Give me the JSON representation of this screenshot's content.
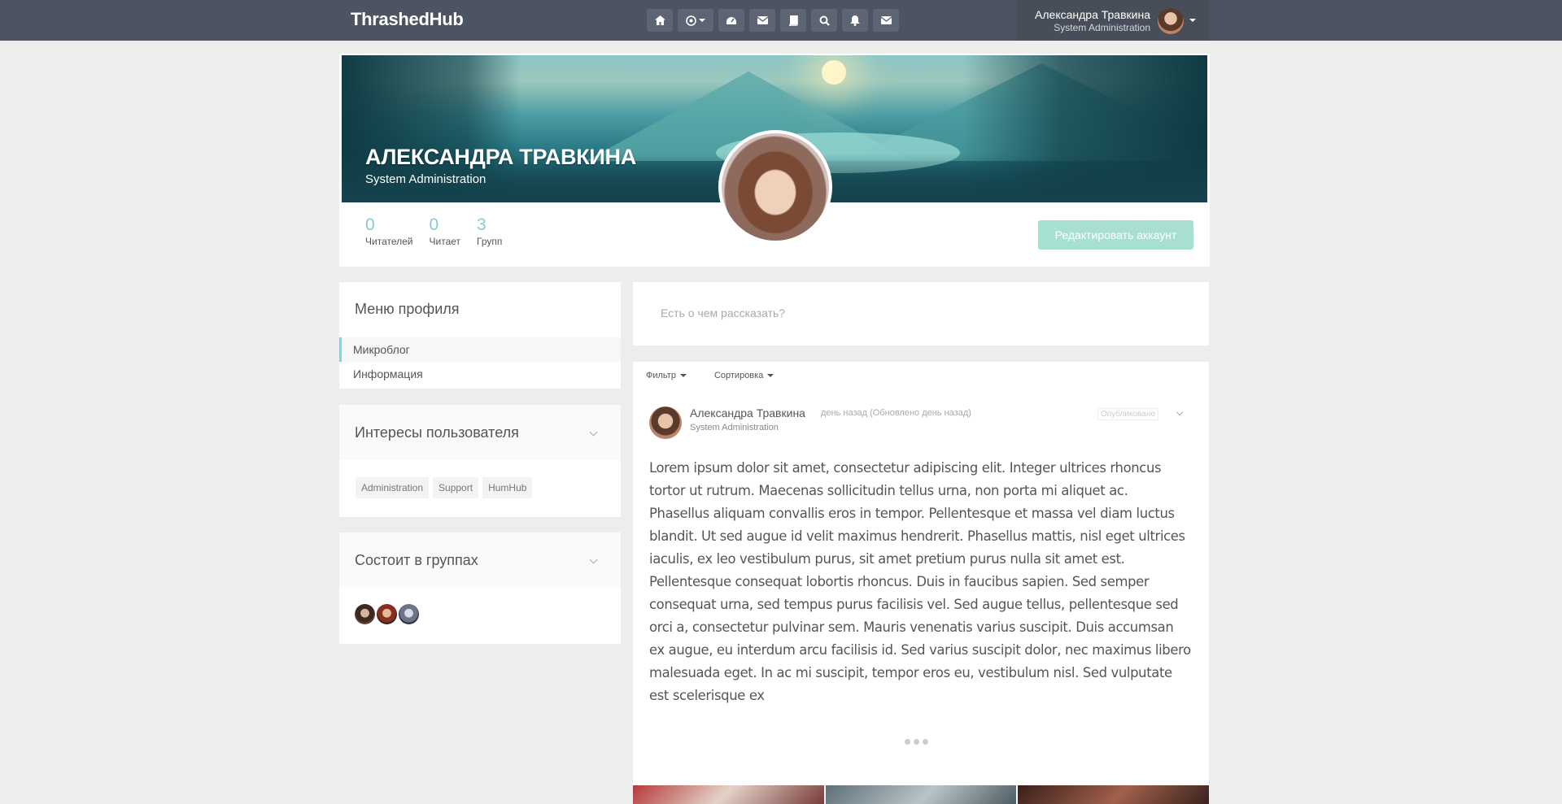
{
  "topbar": {
    "brand": "ThrashedHub",
    "nav_icons": [
      "home-icon",
      "target-icon",
      "dashboard-icon",
      "envelope-icon",
      "book-icon",
      "search-icon",
      "bell-icon",
      "mail-icon"
    ],
    "user": {
      "name": "Александра Травкина",
      "role": "System Administration"
    }
  },
  "profile": {
    "name": "АЛЕКСАНДРА ТРАВКИНА",
    "role": "System Administration",
    "stats": [
      {
        "value": "0",
        "label": "Читателей"
      },
      {
        "value": "0",
        "label": "Читает"
      },
      {
        "value": "3",
        "label": "Групп"
      }
    ],
    "edit_button": "Редактировать аккаунт"
  },
  "menu": {
    "title": "Меню профиля",
    "items": [
      {
        "label": "Микроблог",
        "active": true
      },
      {
        "label": "Информация",
        "active": false
      }
    ]
  },
  "interests": {
    "title": "Интересы пользователя",
    "tags": [
      "Administration",
      "Support",
      "HumHub"
    ]
  },
  "groups": {
    "title": "Состоит в группах",
    "count": 3
  },
  "composer": {
    "placeholder": "Есть о чем рассказать?"
  },
  "stream": {
    "filter_label": "Фильтр",
    "sort_label": "Сортировка",
    "post": {
      "author": "Александра Травкина",
      "time": "день назад (Обновлено день назад)",
      "role": "System Administration",
      "badge": "Опубликовано",
      "text": "Lorem ipsum dolor sit amet, consectetur adipiscing elit. Integer ultrices rhoncus tortor ut rutrum. Maecenas sollicitudin tellus urna, non porta mi aliquet ac. Phasellus aliquam convallis eros in tempor. Pellentesque et massa vel diam luctus blandit. Ut sed augue id velit maximus hendrerit. Phasellus mattis, nisl eget ultrices iaculis, ex leo vestibulum purus, sit amet pretium purus nulla sit amet est. Pellentesque consequat lobortis rhoncus. Duis in faucibus sapien. Sed semper consequat urna, sed tempus purus facilisis vel. Sed augue tellus, pellentesque sed orci a, consectetur pulvinar sem. Mauris venenatis varius suscipit. Duis accumsan ex augue, eu interdum arcu facilisis id. Sed varius suscipit dolor, nec maximus libero malesuada eget. In ac mi suscipit, tempor eros eu, vestibulum nisl. Sed vulputate est scelerisque ex"
    }
  },
  "colors": {
    "topbar": "#4d5461",
    "accent": "#21a1b3",
    "edit_button": "#a7e0d0",
    "page_bg": "#ededed"
  }
}
